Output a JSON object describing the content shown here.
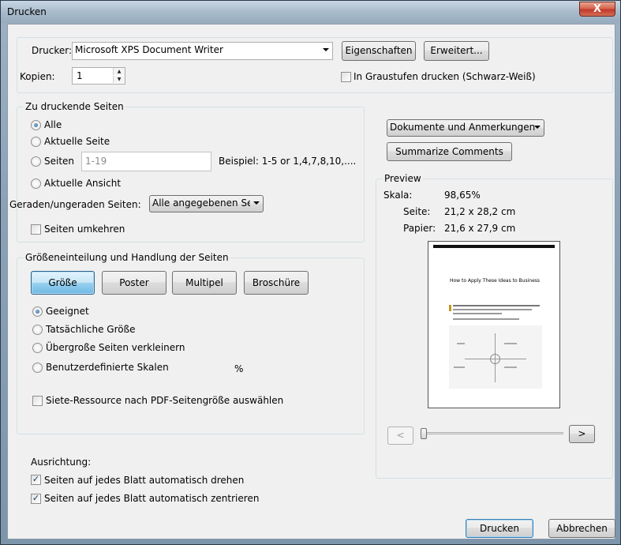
{
  "window": {
    "title": "Drucken",
    "close_glyph": "X"
  },
  "printer": {
    "label": "Drucker:",
    "selected": "Microsoft XPS Document Writer",
    "properties_button": "Eigenschaften",
    "advanced_button": "Erweitert...",
    "copies_label": "Kopien:",
    "copies_value": "1",
    "grayscale_label": "In Graustufen drucken (Schwarz-Weiß)",
    "grayscale_checked": false
  },
  "pages": {
    "legend": "Zu druckende Seiten",
    "options": [
      {
        "label": "Alle",
        "selected": true
      },
      {
        "label": "Aktuelle Seite",
        "selected": false
      },
      {
        "label": "Seiten",
        "selected": false
      },
      {
        "label": "Aktuelle Ansicht",
        "selected": false
      }
    ],
    "range_value": "1-19",
    "range_example": "Beispiel: 1-5 or 1,4,7,8,10,....",
    "odd_even_label": "Geraden/ungeraden Seiten:",
    "odd_even_selected": "Alle angegebenen Seit",
    "reverse_label": "Seiten umkehren",
    "reverse_checked": false
  },
  "sizing": {
    "legend": "Größeneinteilung und Handlung der Seiten",
    "tabs": [
      {
        "label": "Größe",
        "selected": true
      },
      {
        "label": "Poster",
        "selected": false
      },
      {
        "label": "Multipel",
        "selected": false
      },
      {
        "label": "Broschüre",
        "selected": false
      }
    ],
    "options": [
      {
        "label": "Geeignet",
        "selected": true
      },
      {
        "label": "Tatsächliche Größe",
        "selected": false
      },
      {
        "label": "Übergroße Seiten verkleinern",
        "selected": false
      },
      {
        "label": "Benutzerdefinierte Skalen",
        "selected": false
      }
    ],
    "percent_sign": "%",
    "paper_source_label": "Siete-Ressource nach PDF-Seitengröße auswählen",
    "paper_source_checked": false
  },
  "orientation": {
    "label": "Ausrichtung:",
    "auto_rotate_label": "Seiten auf jedes Blatt automatisch drehen",
    "auto_rotate_checked": true,
    "auto_center_label": "Seiten auf jedes Blatt automatisch zentrieren",
    "auto_center_checked": true
  },
  "comments": {
    "selected": "Dokumente und Anmerkungen",
    "summarize_button": "Summarize Comments"
  },
  "preview": {
    "legend": "Preview",
    "scale_label": "Skala:",
    "scale_value": "98,65%",
    "page_label": "Seite:",
    "page_value": "21,2 x 28,2 cm",
    "paper_label": "Papier:",
    "paper_value": "21,6 x 27,9 cm",
    "doc_title": "How to Apply These Ideas to Business",
    "prev_glyph": "<",
    "next_glyph": ">",
    "slider_position": 0
  },
  "footer": {
    "print_button": "Drucken",
    "cancel_button": "Abbrechen"
  }
}
